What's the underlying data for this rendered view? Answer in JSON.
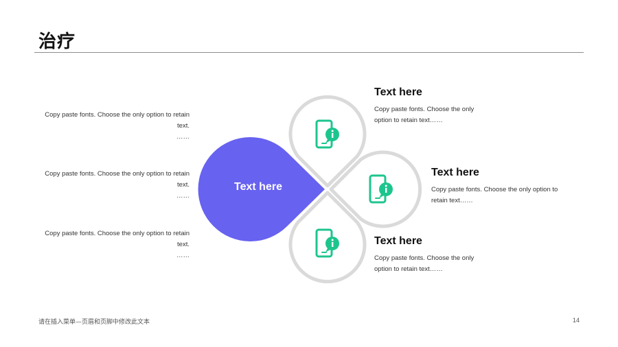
{
  "header": {
    "title": "治疗"
  },
  "left_texts": [
    {
      "body": "Copy paste fonts. Choose the only option to retain text.",
      "ellipsis": "……"
    },
    {
      "body": "Copy paste fonts. Choose the only option to retain text.",
      "ellipsis": "……"
    },
    {
      "body": "Copy paste fonts. Choose the only option to retain text.",
      "ellipsis": "……"
    }
  ],
  "center": {
    "label": "Text here"
  },
  "right_items": [
    {
      "heading": "Text here",
      "desc": "Copy paste fonts. Choose the only option to retain text……"
    },
    {
      "heading": "Text here",
      "desc": "Copy paste fonts. Choose the only option to retain text……"
    },
    {
      "heading": "Text here",
      "desc": "Copy paste fonts. Choose the only option to retain text……"
    }
  ],
  "icons": [
    "mobile-info-icon",
    "mobile-info-icon",
    "mobile-info-icon"
  ],
  "colors": {
    "accent_purple": "#6762F0",
    "accent_green": "#1DC58E",
    "petal_outline": "#DADADA"
  },
  "footer": {
    "note": "请在插入菜单—页眉和页脚中修改此文本",
    "page_number": "14"
  }
}
